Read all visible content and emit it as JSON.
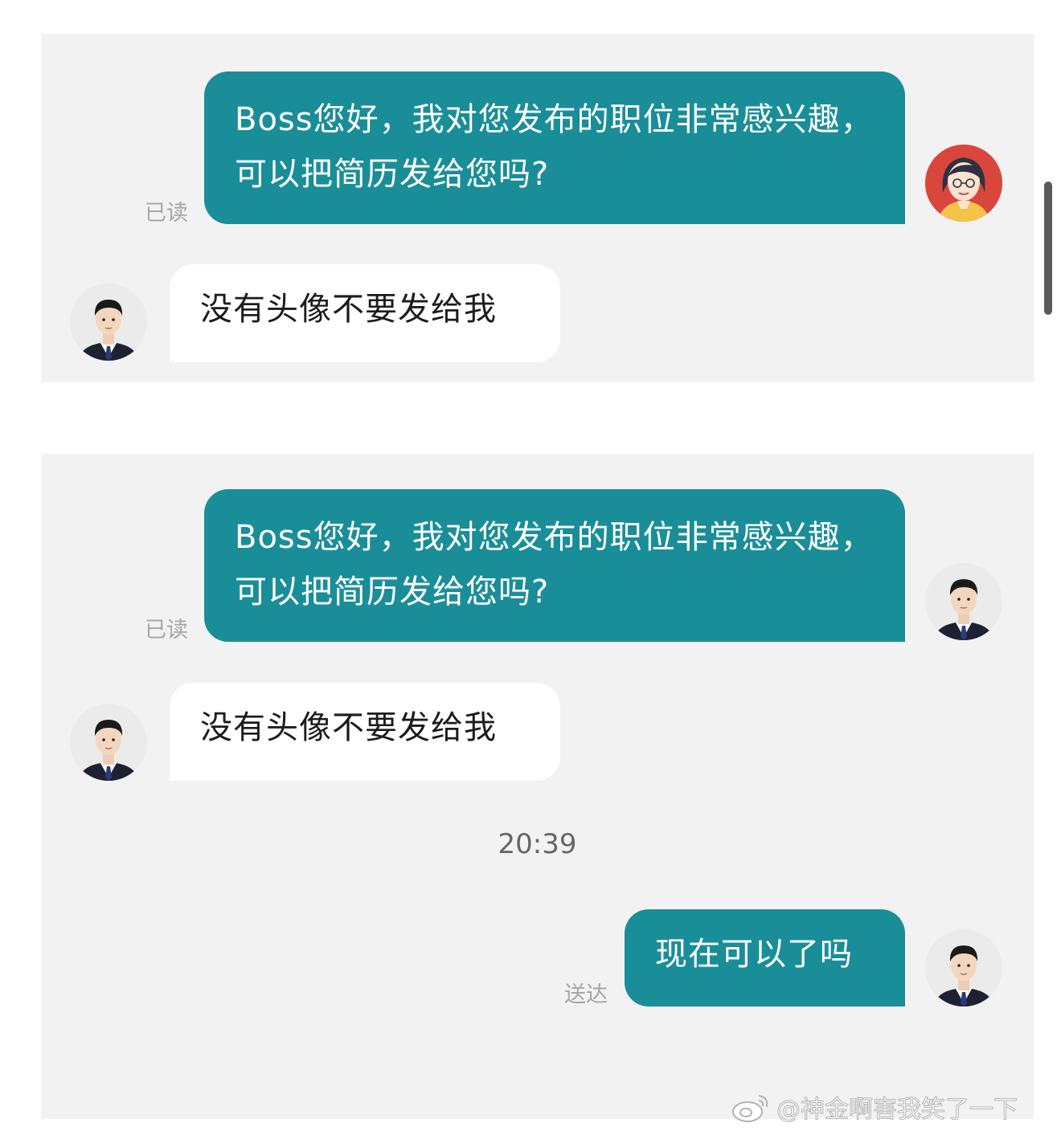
{
  "screenshot_1": {
    "sent_message": "Boss您好，我对您发布的职位非常感兴趣，可以把简历发给您吗?",
    "sent_status": "已读",
    "received_message": "没有头像不要发给我"
  },
  "screenshot_2": {
    "sent_message": "Boss您好，我对您发布的职位非常感兴趣，可以把简历发给您吗?",
    "sent_status": "已读",
    "received_message": "没有头像不要发给我",
    "timestamp": "20:39",
    "second_sent_message": "现在可以了吗",
    "second_sent_status": "送达"
  },
  "avatars": {
    "user_original": "cartoon-woman-avatar",
    "boss": "man-in-suit-avatar",
    "user_changed": "man-in-suit-avatar"
  },
  "colors": {
    "sent_bubble": "#1a8e98",
    "received_bubble": "#ffffff",
    "panel_background": "#f2f2f2"
  },
  "watermark": {
    "text": "@神金啊害我笑了一下",
    "icon": "weibo-logo-icon"
  }
}
